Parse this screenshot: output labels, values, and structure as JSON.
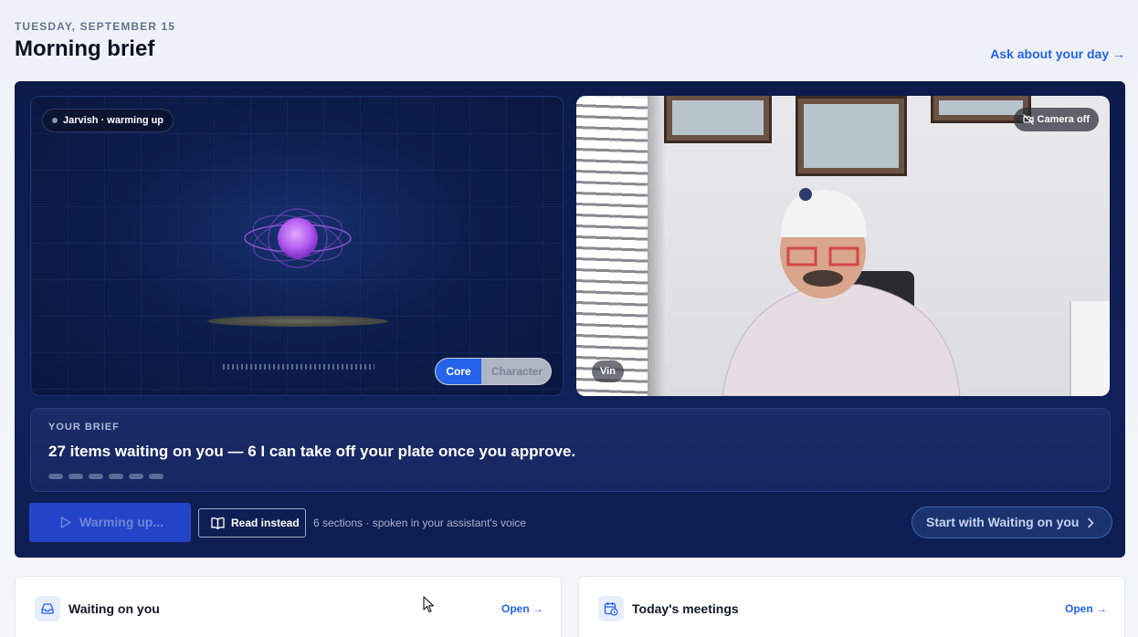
{
  "header": {
    "date": "TUESDAY, SEPTEMBER 15",
    "title": "Morning brief",
    "ask_link": "Ask about your day →"
  },
  "assistant_panel": {
    "status": "Jarvish · warming up",
    "mode_toggle": {
      "options": [
        "Core",
        "Character"
      ],
      "selected": "Core"
    },
    "icon": "orb-avatar-icon"
  },
  "camera_panel": {
    "camera_toggle": "Camera off",
    "participant_name": "Vin",
    "icon": "camera-off-icon"
  },
  "brief": {
    "kicker": "YOUR BRIEF",
    "headline": "27 items waiting on you — 6 I can take off your plate once you approve.",
    "sections_total": 6
  },
  "controls": {
    "play_label": "Warming up...",
    "read_label": "Read instead",
    "sections_note": "6 sections · spoken in your assistant's voice",
    "start_label": "Start with Waiting on you"
  },
  "cards": [
    {
      "title": "Waiting on you",
      "open_label": "Open →",
      "icon": "inbox-icon"
    },
    {
      "title": "Today's meetings",
      "open_label": "Open →",
      "icon": "calendar-clock-icon"
    }
  ],
  "colors": {
    "accent": "#2563eb",
    "hero_bg": "#0c1b4a",
    "page_bg": "#eef2f8"
  }
}
